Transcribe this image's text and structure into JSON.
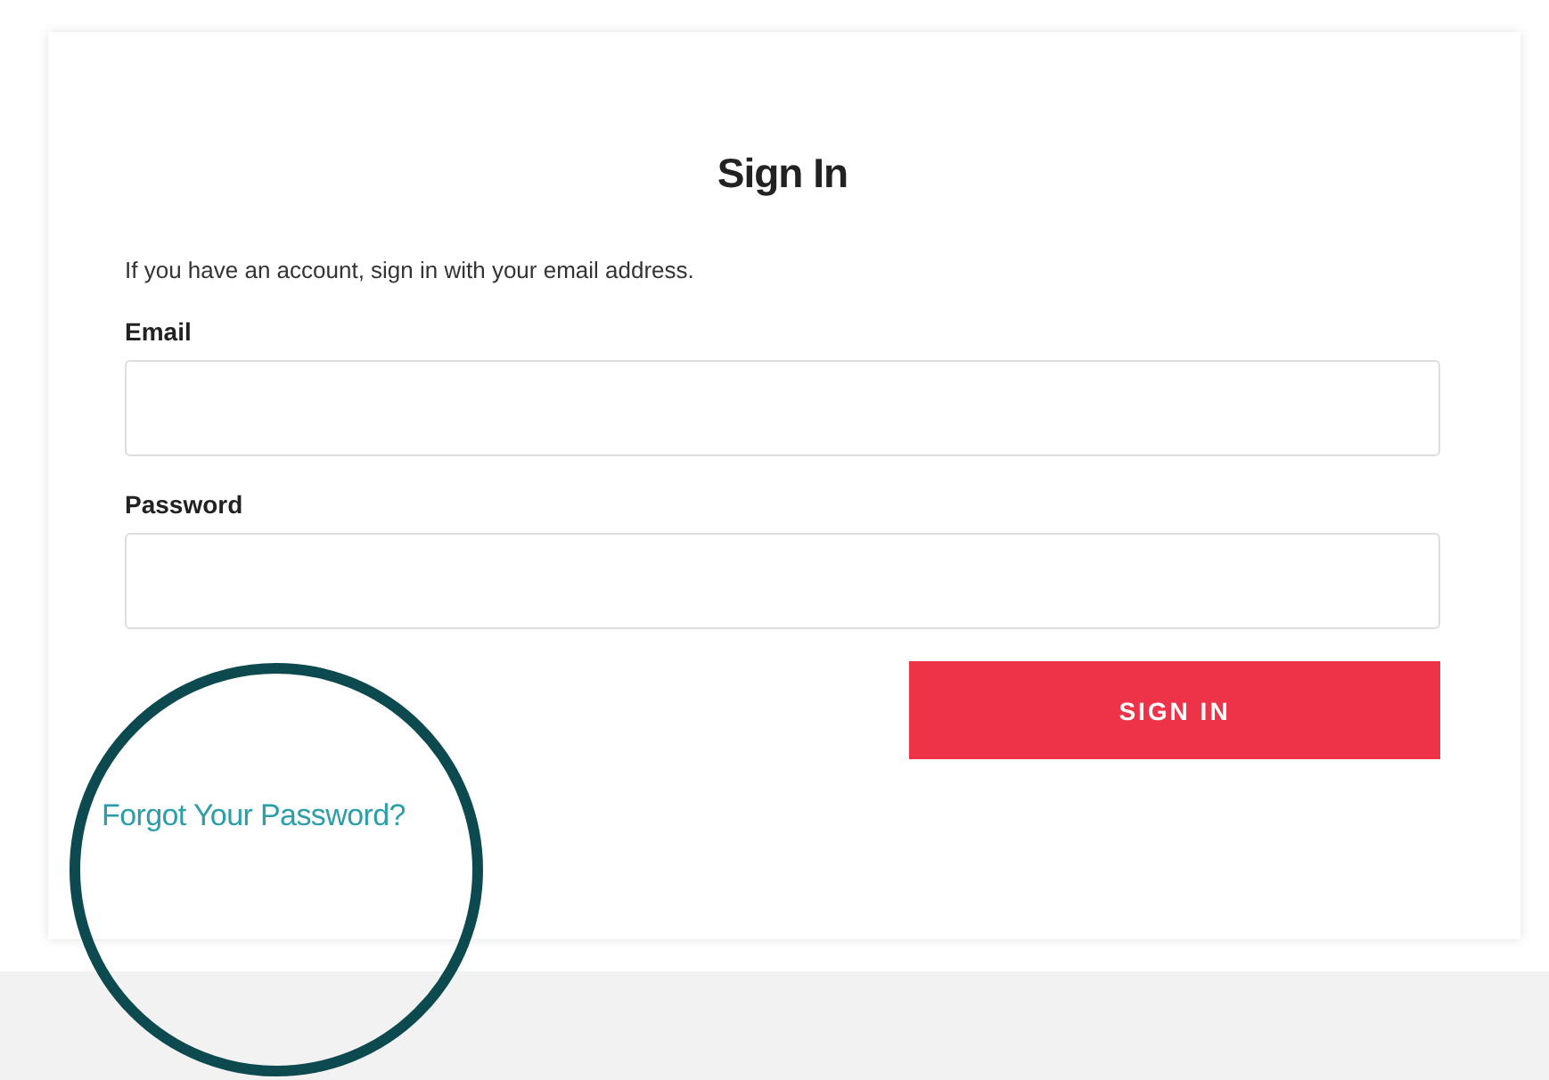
{
  "form": {
    "title": "Sign In",
    "intro": "If you have an account, sign in with your email address.",
    "fields": [
      {
        "label": "Email"
      },
      {
        "label": "Password"
      }
    ],
    "submit": "SIGN IN",
    "forgot_link": "Forgot Your Password?"
  },
  "annotation": {
    "kind": "circle"
  }
}
